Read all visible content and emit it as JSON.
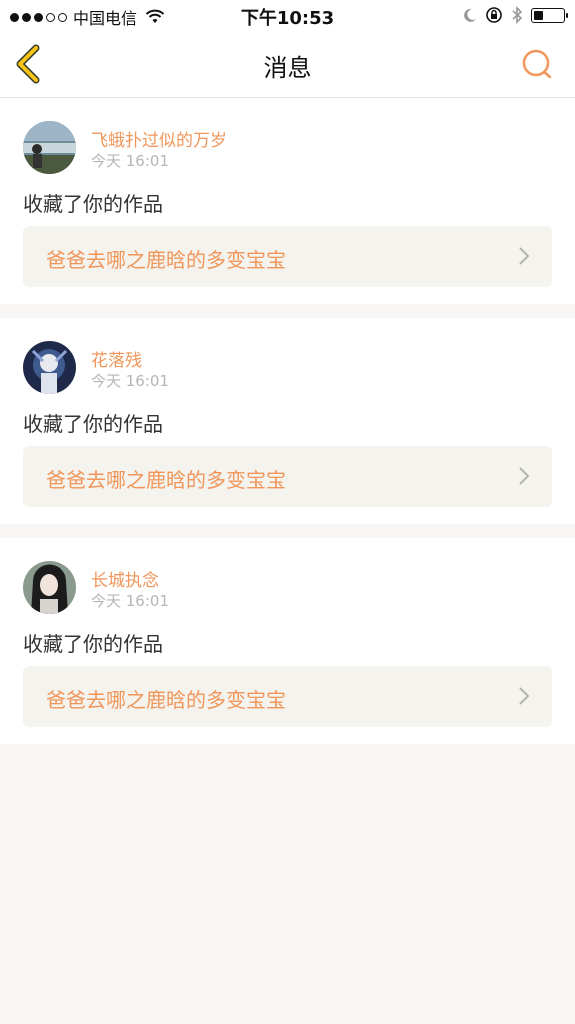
{
  "status_bar": {
    "carrier": "中国电信",
    "time": "下午10:53",
    "battery_level": 0.35
  },
  "nav": {
    "title": "消息",
    "back_icon": "chevron-left-icon",
    "search_icon": "search-icon",
    "accent_color": "#f0965a"
  },
  "messages": [
    {
      "user": "飞蛾扑过似的万岁",
      "time": "今天 16:01",
      "action": "收藏了你的作品",
      "work_title": "爸爸去哪之鹿晗的多变宝宝"
    },
    {
      "user": "花落残",
      "time": "今天 16:01",
      "action": "收藏了你的作品",
      "work_title": "爸爸去哪之鹿晗的多变宝宝"
    },
    {
      "user": "长城执念",
      "time": "今天 16:01",
      "action": "收藏了你的作品",
      "work_title": "爸爸去哪之鹿晗的多变宝宝"
    }
  ]
}
